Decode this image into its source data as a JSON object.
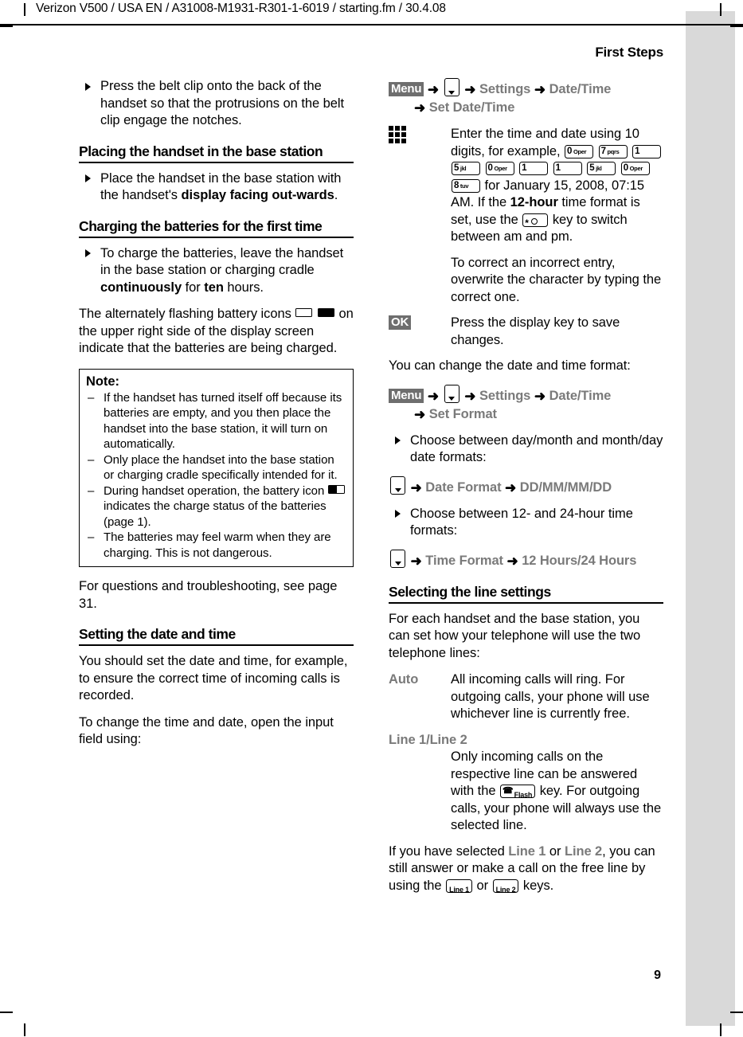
{
  "printer": {
    "running_header": "Verizon V500 / USA EN / A31008-M1931-R301-1-6019 / starting.fm / 30.4.08",
    "chapter_title": "First Steps",
    "page_number": "9",
    "tab_color": "#d9d9d9"
  },
  "left_column": {
    "bullet_beltclip": "Press the belt clip onto the back of the handset so that the protrusions on the belt clip engage the notches.",
    "heading_placing": "Placing the handset in the base station",
    "bullet_placing_1": "Place the handset in the base station with the handset's ",
    "bullet_placing_2": "display facing out-wards",
    "bullet_placing_3": ".",
    "heading_charging": "Charging the batteries for the first time",
    "bullet_charge_1": "To charge the batteries, leave the handset in the base station or charging cradle ",
    "bullet_charge_2": "continuously",
    "bullet_charge_3": " for ",
    "bullet_charge_4": "ten",
    "bullet_charge_5": " hours.",
    "para_flashing_1": "The alternately flashing battery icons",
    "para_flashing_2": "on the upper right side of the display screen indicate that the batteries are being charged.",
    "note": {
      "title": "Note:",
      "items": [
        "If the handset has turned itself off because its batteries are empty, and you then place the handset into the base station, it will turn on automatically.",
        "Only place the handset into the base station or charging cradle specifically intended for it.",
        "The batteries may feel warm when they are charging. This is not dangerous."
      ],
      "item3_pre": "During handset operation, the battery icon",
      "item3_post": "indicates the charge status of the batteries (page 1).",
      "dash": "–"
    },
    "para_questions": "For questions and troubleshooting, see page 31.",
    "heading_datetime": "Setting the date and time",
    "para_should_set": "You should set the date and time, for example, to ensure the correct time of incoming calls is recorded.",
    "para_to_change": "To change the time and date, open the input field using:"
  },
  "right_column": {
    "path_set_datetime": {
      "softkey": "Menu",
      "arrow": "➜",
      "items": [
        "Settings",
        "Date/Time"
      ],
      "continuation": "Set Date/Time"
    },
    "step_enter": {
      "text_1": "Enter the time and date using 10 digits, for example,",
      "keys": [
        {
          "digit": "0",
          "letters": "Oper"
        },
        {
          "digit": "7",
          "letters": "pqrs"
        },
        {
          "digit": "1",
          "letters": ""
        },
        {
          "digit": "5",
          "letters": "jkl"
        },
        {
          "digit": "0",
          "letters": "Oper"
        },
        {
          "digit": "1",
          "letters": ""
        },
        {
          "digit": "1",
          "letters": ""
        },
        {
          "digit": "5",
          "letters": "jkl"
        },
        {
          "digit": "0",
          "letters": "Oper"
        },
        {
          "digit": "8",
          "letters": "tuv"
        }
      ],
      "text_2": "for January 15, 2008, 07:15 AM. If the ",
      "text_3": "12-hour",
      "text_4": " time format is set, use the",
      "text_5": "key to switch between am and pm.",
      "text_6": "To correct an incorrect entry, overwrite the character by typing the correct one."
    },
    "step_ok": {
      "softkey": "OK",
      "text": "Press the display key to save changes."
    },
    "para_change_format": "You can change the date and time format:",
    "path_set_format": {
      "softkey": "Menu",
      "arrow": "➜",
      "items": [
        "Settings",
        "Date/Time"
      ],
      "continuation": "Set Format"
    },
    "bullet_date_formats": "Choose between day/month and month/day date formats:",
    "path_date_format": {
      "arrow": "➜",
      "label": "Date Format",
      "value": "DD/MM/MM/DD"
    },
    "bullet_time_formats": "Choose between 12- and 24-hour time formats:",
    "path_time_format": {
      "arrow": "➜",
      "label": "Time Format",
      "value": "12 Hours/24 Hours"
    },
    "heading_line_settings": "Selecting the line settings",
    "para_for_each": "For each handset and the base station, you can set how your telephone will use the two telephone lines:",
    "def_auto": {
      "term": "Auto",
      "desc": "All incoming calls will ring. For outgoing calls, your phone will use whichever line is currently free."
    },
    "def_line12": {
      "term": "Line 1/Line 2",
      "desc_1": "Only incoming calls on the respective line can be answered with the",
      "flash_key": "Flash",
      "desc_2": "key. For outgoing calls, your phone will always use the selected line."
    },
    "para_if_selected": {
      "text_1": "If you have selected ",
      "line1": "Line 1",
      "text_2": " or ",
      "line2": "Line 2",
      "text_3": ", you can still answer or make a call on the free line by using the",
      "key_line1": "Line 1",
      "text_4": "or",
      "key_line2": "Line 2",
      "text_5": "keys."
    }
  }
}
